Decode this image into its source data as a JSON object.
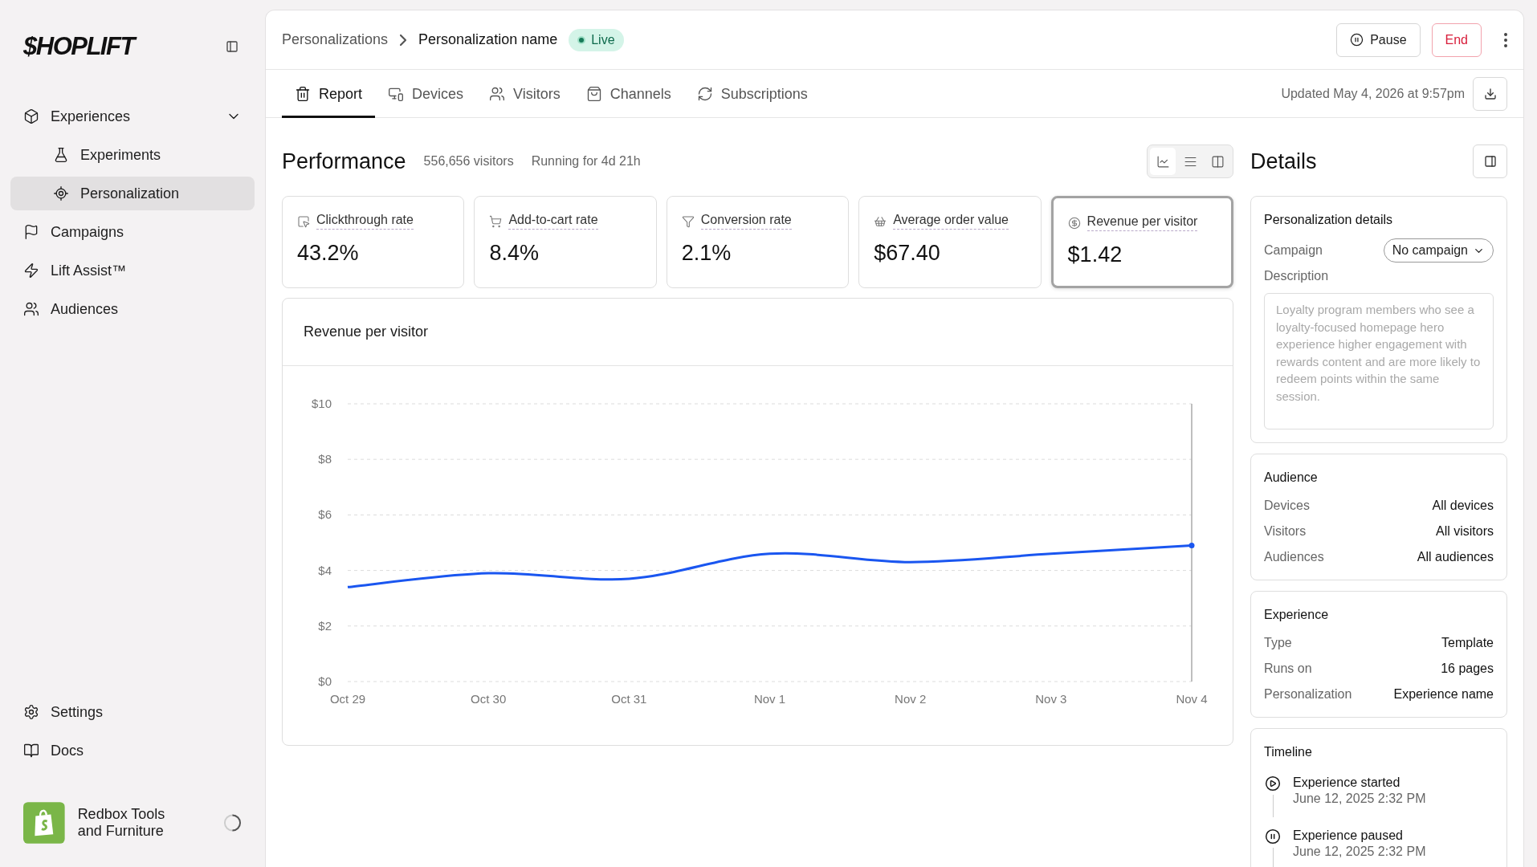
{
  "sidebar": {
    "logo": "$HOPLIFT",
    "nav": [
      {
        "label": "Experiences",
        "selected": false,
        "expanded": true,
        "children": [
          {
            "label": "Experiments",
            "selected": false
          },
          {
            "label": "Personalization",
            "selected": true
          }
        ]
      },
      {
        "label": "Campaigns",
        "selected": false
      },
      {
        "label": "Lift Assist™",
        "selected": false
      },
      {
        "label": "Audiences",
        "selected": false
      }
    ],
    "footer_nav": [
      {
        "label": "Settings",
        "selected": false
      },
      {
        "label": "Docs",
        "selected": false
      }
    ],
    "store": {
      "name": "Redbox Tools and Furniture"
    }
  },
  "breadcrumb": [
    "Personalizations",
    "Personalization name"
  ],
  "status": {
    "label": "Live"
  },
  "actions": [
    {
      "kind": "pause",
      "label": "Pause"
    },
    {
      "kind": "end",
      "label": "End"
    }
  ],
  "tabs": [
    {
      "label": "Report",
      "selected": true
    },
    {
      "label": "Devices",
      "selected": false
    },
    {
      "label": "Visitors",
      "selected": false
    },
    {
      "label": "Channels",
      "selected": false
    },
    {
      "label": "Subscriptions",
      "selected": false
    }
  ],
  "updated": "Updated May 4, 2026 at 9:57pm",
  "performance": {
    "title": "Performance",
    "visitors": "556,656 visitors",
    "running": "Running for 4d 21h",
    "view_modes": [
      {
        "selected": true
      },
      {
        "selected": false
      },
      {
        "selected": false
      }
    ]
  },
  "metrics": [
    {
      "label": "Clickthrough rate",
      "value": "43.2%",
      "selected": false
    },
    {
      "label": "Add-to-cart rate",
      "value": "8.4%",
      "selected": false
    },
    {
      "label": "Conversion rate",
      "value": "2.1%",
      "selected": false
    },
    {
      "label": "Average order value",
      "value": "$67.40",
      "selected": false
    },
    {
      "label": "Revenue per visitor",
      "value": "$1.42",
      "selected": true
    }
  ],
  "chart_panel": {
    "chart_data": {
      "type": "line",
      "title": "Revenue per visitor",
      "grid": true,
      "categories": [
        "Oct 29",
        "Oct 30",
        "Oct 31",
        "Nov 1",
        "Nov 2",
        "Nov 3",
        "Nov 4"
      ],
      "series": [
        {
          "color": "#1a56f0",
          "values": [
            3.4,
            3.9,
            3.7,
            4.6,
            4.3,
            4.6,
            4.9
          ]
        }
      ],
      "ylim": [
        0,
        10
      ],
      "yticks": [
        {
          "value": 0,
          "label": "$0"
        },
        {
          "value": 2,
          "label": "$2"
        },
        {
          "value": 4,
          "label": "$4"
        },
        {
          "value": 6,
          "label": "$6"
        },
        {
          "value": 8,
          "label": "$8"
        },
        {
          "value": 10,
          "label": "$10"
        }
      ]
    }
  },
  "details": {
    "title": "Details",
    "personalization": {
      "title": "Personalization details",
      "campaign_label": "Campaign",
      "campaign_value": "No campaign",
      "description_label": "Description",
      "description_placeholder": "Loyalty program members who see a loyalty-focused homepage hero experience higher engagement with rewards content and are more likely to redeem points within the same session."
    },
    "sections": [
      {
        "title": "Audience",
        "rows": [
          {
            "label": "Devices",
            "value": "All devices"
          },
          {
            "label": "Visitors",
            "value": "All visitors"
          },
          {
            "label": "Audiences",
            "value": "All audiences"
          }
        ]
      },
      {
        "title": "Experience",
        "rows": [
          {
            "label": "Type",
            "value": "Template"
          },
          {
            "label": "Runs on",
            "value": "16 pages"
          },
          {
            "label": "Personalization",
            "value": "Experience name"
          }
        ]
      }
    ],
    "timeline": {
      "title": "Timeline",
      "events": [
        {
          "kind": "started",
          "label": "Experience started",
          "time": "June 12, 2025 2:32 PM"
        },
        {
          "kind": "paused",
          "label": "Experience paused",
          "time": "June 12, 2025 2:32 PM"
        }
      ]
    }
  }
}
